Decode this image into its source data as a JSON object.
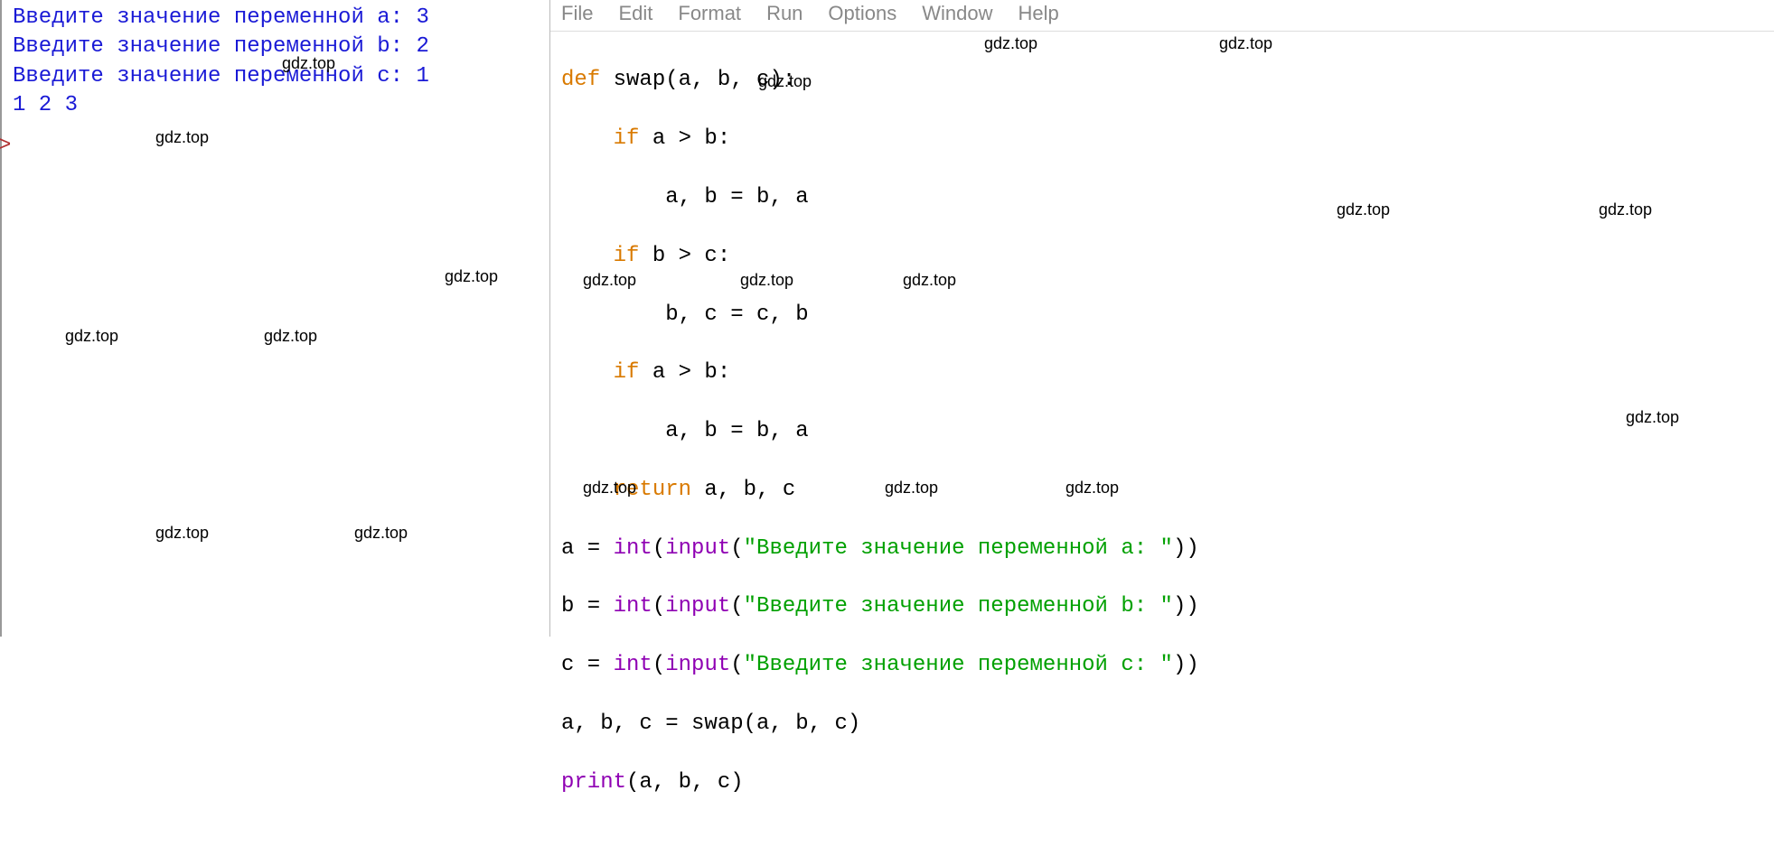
{
  "shell": {
    "lines": [
      "Введите значение переменной a: 3",
      "Введите значение переменной b: 2",
      "Введите значение переменной c: 1",
      "1 2 3"
    ],
    "prompt": ">"
  },
  "menu": {
    "file": "File",
    "edit": "Edit",
    "format": "Format",
    "run": "Run",
    "options": "Options",
    "window": "Window",
    "help": "Help"
  },
  "code": {
    "l1_def": "def",
    "l1_rest": " swap(a, b, c):",
    "l2_if": "if",
    "l2_rest": " a > b:",
    "l3": "        a, b = b, a",
    "l4_if": "if",
    "l4_rest": " b > c:",
    "l5": "        b, c = c, b",
    "l6_if": "if",
    "l6_rest": " a > b:",
    "l7": "        a, b = b, a",
    "l8_ret": "return",
    "l8_rest": " a, b, c",
    "l9a": "a = ",
    "l9int": "int",
    "l9b": "(",
    "l9inp": "input",
    "l9c": "(",
    "l9str": "\"Введите значение переменной a: \"",
    "l9d": "))",
    "l10a": "b = ",
    "l10str": "\"Введите значение переменной b: \"",
    "l11a": "c = ",
    "l11str": "\"Введите значение переменной c: \"",
    "l12": "a, b, c = swap(a, b, c)",
    "l13print": "print",
    "l13rest": "(a, b, c)"
  },
  "watermark": "gdz.top"
}
